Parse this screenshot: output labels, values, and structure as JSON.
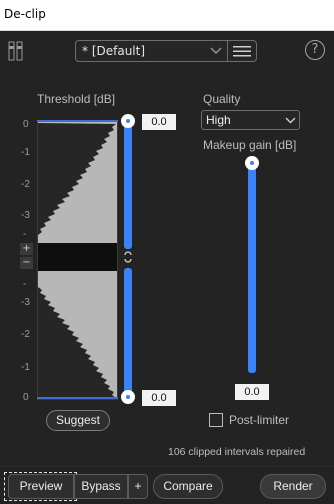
{
  "window": {
    "title": "De-clip"
  },
  "toolbar": {
    "preset": "* [Default]",
    "help": "?"
  },
  "threshold": {
    "label": "Threshold [dB]",
    "ticks_top": [
      "0",
      "-1",
      "-2",
      "-3"
    ],
    "ticks_bottom": [
      "-3",
      "-2",
      "-1",
      "0"
    ],
    "minus_inf_top": "-",
    "minus_inf_bottom": "-",
    "plus_btn": "+",
    "minus_btn": "−",
    "upper_value": "0.0",
    "lower_value": "0.0",
    "suggest_label": "Suggest"
  },
  "quality": {
    "label": "Quality",
    "value": "High"
  },
  "makeup": {
    "label": "Makeup gain [dB]",
    "value": "0.0"
  },
  "post_limiter": {
    "label": "Post-limiter",
    "checked": false
  },
  "status": "106 clipped intervals repaired",
  "bottom": {
    "preview": "Preview",
    "bypass": "Bypass",
    "plus": "+",
    "compare": "Compare",
    "render": "Render"
  }
}
